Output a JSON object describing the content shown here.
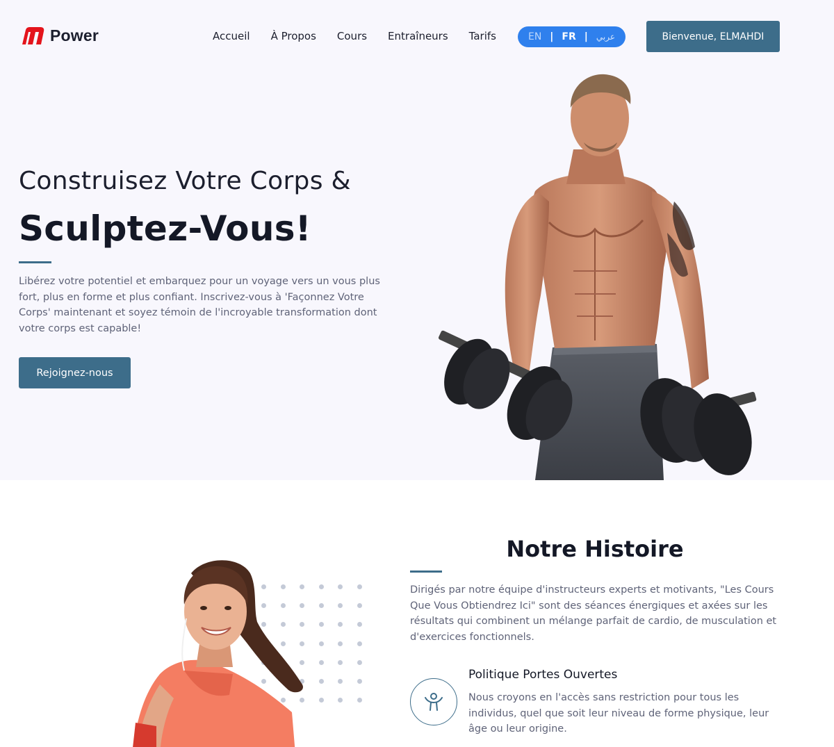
{
  "brand": {
    "name": "Power",
    "logo_color": "#e4141c"
  },
  "nav": {
    "links": [
      "Accueil",
      "À Propos",
      "Cours",
      "Entraîneurs",
      "Tarifs"
    ]
  },
  "language": {
    "options": [
      "EN",
      "FR",
      "عربي"
    ],
    "selected": "FR",
    "separator": "|",
    "color": "#2f80ed"
  },
  "user": {
    "welcome_label": "Bienvenue, ELMAHDI"
  },
  "hero": {
    "title_line1": "Construisez Votre Corps &",
    "title_line2": "Sculptez-Vous!",
    "description": "Libérez votre potentiel et embarquez pour un voyage vers un vous plus fort, plus en forme et plus confiant. Inscrivez-vous à 'Façonnez Votre Corps' maintenant et soyez témoin de l'incroyable transformation dont votre corps est capable!",
    "cta_label": "Rejoignez-nous"
  },
  "story": {
    "title": "Notre Histoire",
    "description": "Dirigés par notre équipe d'instructeurs experts et motivants, \"Les Cours Que Vous Obtiendrez Ici\" sont des séances énergiques et axées sur les résultats qui combinent un mélange parfait de cardio, de musculation et d'exercices fonctionnels.",
    "feature": {
      "icon": "open-arms-person-icon",
      "title": "Politique Portes Ouvertes",
      "description": "Nous croyons en l'accès sans restriction pour tous les individus, quel que soit leur niveau de forme physique, leur âge ou leur origine."
    }
  },
  "colors": {
    "primary": "#3d6d8a",
    "hero_bg": "#f8f7fd",
    "text_dark": "#141826",
    "text_muted": "#5f6378"
  }
}
